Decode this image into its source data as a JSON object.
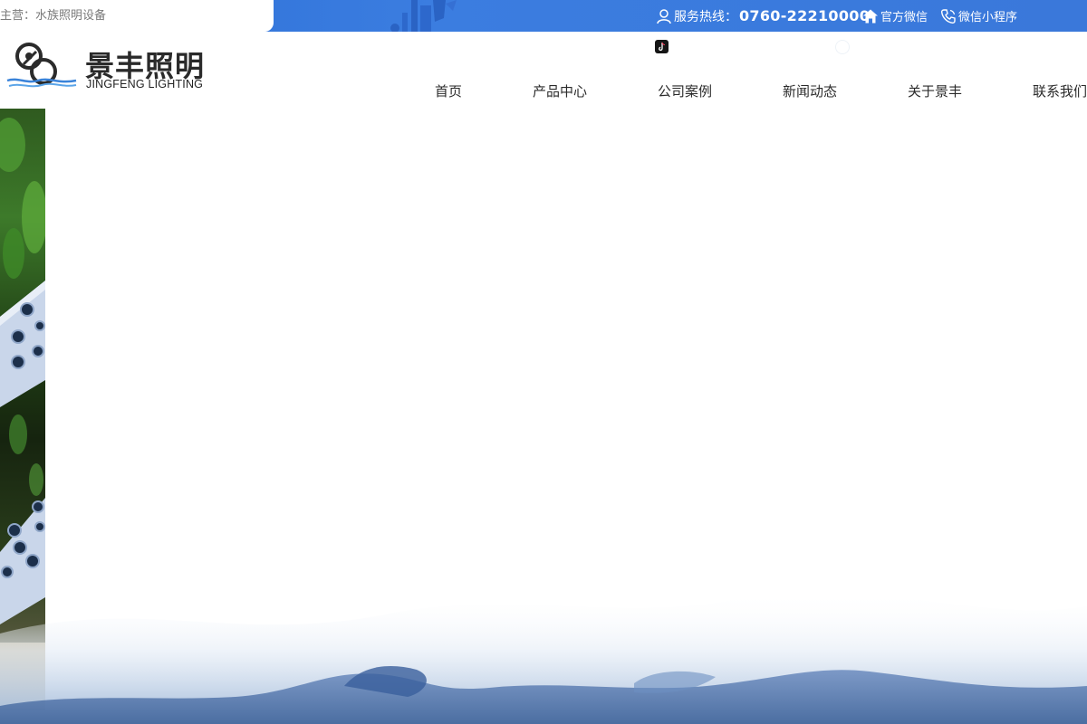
{
  "topbar": {
    "main_business": "主营：水族照明设备",
    "hotline_label": "服务热线：",
    "hotline_number": "0760-22210000",
    "wechat_label": "官方微信",
    "mini_program_label": "微信小程序"
  },
  "header": {
    "logo_cn": "景丰照明",
    "logo_en": "JINGFENG LIGHTING"
  },
  "nav": {
    "items": [
      {
        "label": "首页"
      },
      {
        "label": "产品中心"
      },
      {
        "label": "公司案例"
      },
      {
        "label": "新闻动态"
      },
      {
        "label": "关于景丰"
      },
      {
        "label": "联系我们"
      }
    ]
  },
  "colors": {
    "topbar_blue": "#3478dc",
    "text_dark": "#2b2b2b",
    "text_muted": "#7a7a7a"
  },
  "icons": {
    "hotline": "user-icon",
    "wechat": "home-icon",
    "mini_program": "phone-icon",
    "tiktok": "tiktok-icon",
    "clock": "clock-icon"
  }
}
